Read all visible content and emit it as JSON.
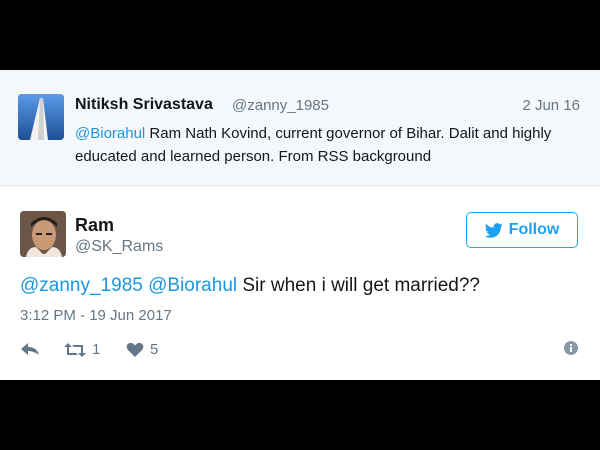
{
  "quoted_tweet": {
    "name": "Nitiksh Srivastava",
    "handle": "@zanny_1985",
    "date": "2 Jun 16",
    "mention": "@Biorahul",
    "text": " Ram Nath Kovind, current governor of Bihar. Dalit and highly educated and learned person. From RSS background"
  },
  "tweet": {
    "name": "Ram",
    "handle": "@SK_Rams",
    "follow_label": "Follow",
    "mention_1": "@zanny_1985",
    "mention_2": "@Biorahul",
    "text": " Sir when i will get married??",
    "timestamp": "3:12 PM - 19 Jun 2017",
    "retweet_count": "1",
    "like_count": "5"
  },
  "colors": {
    "accent": "#1da1f2",
    "mention": "#1b95e0",
    "muted": "#657786"
  }
}
